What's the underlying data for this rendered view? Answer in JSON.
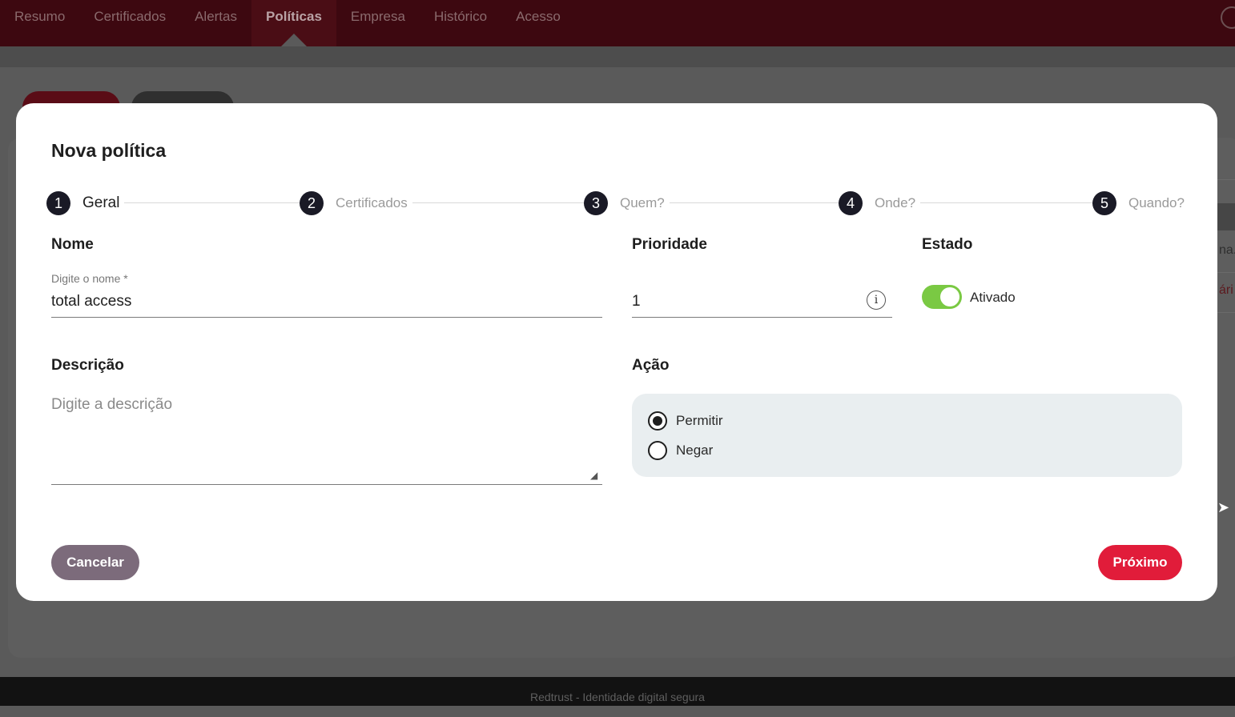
{
  "nav": {
    "items": [
      "Resumo",
      "Certificados",
      "Alertas",
      "Políticas",
      "Empresa",
      "Histórico",
      "Acesso"
    ],
    "active_index": 3
  },
  "background": {
    "right_text_1": "na.",
    "right_text_2": "ári"
  },
  "footer": {
    "text": "Redtrust - Identidade digital segura"
  },
  "modal": {
    "title": "Nova política",
    "steps": [
      {
        "num": "1",
        "label": "Geral"
      },
      {
        "num": "2",
        "label": "Certificados"
      },
      {
        "num": "3",
        "label": "Quem?"
      },
      {
        "num": "4",
        "label": "Onde?"
      },
      {
        "num": "5",
        "label": "Quando?"
      }
    ],
    "active_step": 0,
    "name": {
      "section": "Nome",
      "hint": "Digite o nome *",
      "value": "total access"
    },
    "priority": {
      "section": "Prioridade",
      "value": "1",
      "info_icon": "info-icon"
    },
    "state": {
      "section": "Estado",
      "toggle_label": "Ativado",
      "enabled": true
    },
    "description": {
      "section": "Descrição",
      "placeholder": "Digite a descrição",
      "value": ""
    },
    "action": {
      "section": "Ação",
      "options": [
        "Permitir",
        "Negar"
      ],
      "selected": "Permitir"
    },
    "buttons": {
      "cancel": "Cancelar",
      "next": "Próximo"
    }
  },
  "colors": {
    "nav_bg": "#3d0810",
    "primary": "#e11c3a",
    "cancel": "#7c6b7b",
    "toggle_on": "#7ac943",
    "step_circle": "#1a1a26"
  }
}
